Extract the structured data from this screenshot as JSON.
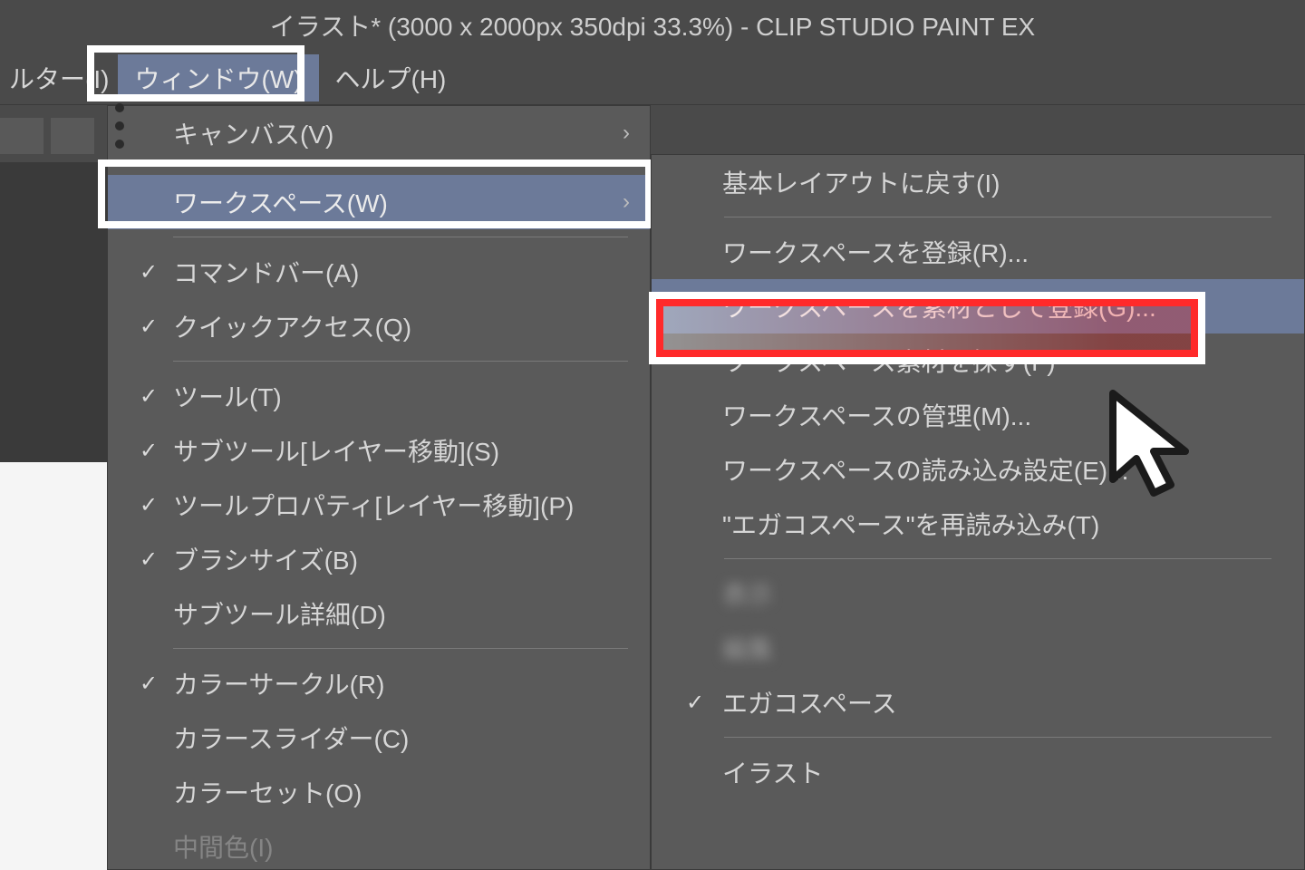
{
  "title": "イラスト* (3000 x 2000px 350dpi 33.3%)  -  CLIP STUDIO PAINT EX",
  "menubar": {
    "filter": "ルター(I)",
    "window": "ウィンドウ(W)",
    "help": "ヘルプ(H)"
  },
  "main_menu": {
    "canvas": "キャンバス(V)",
    "workspace": "ワークスペース(W)",
    "command_bar": "コマンドバー(A)",
    "quick_access": "クイックアクセス(Q)",
    "tool": "ツール(T)",
    "subtool_layermove": "サブツール[レイヤー移動](S)",
    "toolprop_layermove": "ツールプロパティ[レイヤー移動](P)",
    "brush_size": "ブラシサイズ(B)",
    "subtool_detail": "サブツール詳細(D)",
    "color_circle": "カラーサークル(R)",
    "color_slider": "カラースライダー(C)",
    "color_set": "カラーセット(O)",
    "cutoff": "中間色(I)"
  },
  "submenu": {
    "reset_default": "基本レイアウトに戻す(I)",
    "register": "ワークスペースを登録(R)...",
    "register_as_mat": "ワークスペースを素材として登録(G)...",
    "find_mat": "ワークスペース素材を探す(F)",
    "manage": "ワークスペースの管理(M)...",
    "import_setting": "ワークスペースの読み込み設定(E)...",
    "reread_named": "\"エガコスペース\"を再読み込み(T)",
    "blur1": "表示",
    "blur2": "編集",
    "named_ws": "エガコスペース",
    "illust_ws": "イラスト"
  }
}
